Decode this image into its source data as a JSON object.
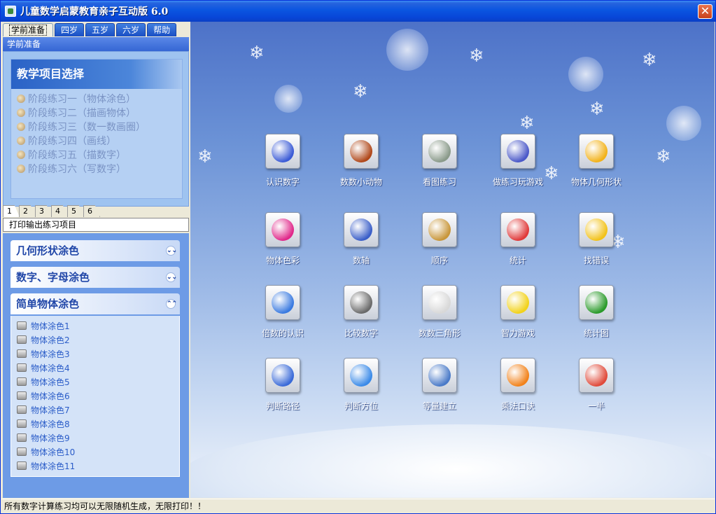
{
  "window": {
    "title": "儿童数学启蒙教育亲子互动版 6.0",
    "close_label": "✕"
  },
  "top_tabs": [
    "学前准备",
    "四岁",
    "五岁",
    "六岁",
    "帮助"
  ],
  "panel_header": "学前准备",
  "project_select": {
    "title": "教学项目选择",
    "items": [
      "阶段练习一（物体涂色）",
      "阶段练习二（描画物体）",
      "阶段练习三（数一数画圈）",
      "阶段练习四（画线）",
      "阶段练习五（描数字）",
      "阶段练习六（写数字）"
    ]
  },
  "page_tabs": [
    "1",
    "2",
    "3",
    "4",
    "5",
    "6"
  ],
  "print_section": "打印输出练习项目",
  "groups": [
    {
      "title": "几何形状涂色",
      "chevron": "⌄⌄"
    },
    {
      "title": "数字、字母涂色",
      "chevron": "⌄⌄"
    },
    {
      "title": "简单物体涂色",
      "chevron": "⌃⌃"
    }
  ],
  "leaves": [
    "物体涂色1",
    "物体涂色2",
    "物体涂色3",
    "物体涂色4",
    "物体涂色5",
    "物体涂色6",
    "物体涂色7",
    "物体涂色8",
    "物体涂色9",
    "物体涂色10",
    "物体涂色11"
  ],
  "icons": [
    {
      "label": "认识数字",
      "icon": "record-disc-icon",
      "color": "#3b5bd6"
    },
    {
      "label": "数数小动物",
      "icon": "animal-icon",
      "color": "#b0481a"
    },
    {
      "label": "看图练习",
      "icon": "calculator-icon",
      "color": "#8a9a8a"
    },
    {
      "label": "做练习玩游戏",
      "icon": "gameboy-icon",
      "color": "#4a58c8"
    },
    {
      "label": "物体几何形状",
      "icon": "star-icon",
      "color": "#f2b21a"
    },
    {
      "label": "物体色彩",
      "icon": "color-balls-icon",
      "color": "#e0288a"
    },
    {
      "label": "数轴",
      "icon": "blueprint-icon",
      "color": "#3a5ec8"
    },
    {
      "label": "顺序",
      "icon": "box-icon",
      "color": "#c8963a"
    },
    {
      "label": "统计",
      "icon": "red-button-icon",
      "color": "#e03a3a"
    },
    {
      "label": "找错误",
      "icon": "star-card-icon",
      "color": "#f2c21a"
    },
    {
      "label": "倍数的认识",
      "icon": "drive-icon",
      "color": "#3a7ae0"
    },
    {
      "label": "比较数字",
      "icon": "tools-icon",
      "color": "#6a6a6a"
    },
    {
      "label": "数数三角形",
      "icon": "mouse-icon",
      "color": "#d8d8d8"
    },
    {
      "label": "智力游戏",
      "icon": "car-icon",
      "color": "#f2d21a"
    },
    {
      "label": "统计图",
      "icon": "green-k-icon",
      "color": "#2a9a2a"
    },
    {
      "label": "判断路径",
      "icon": "spiral-icon",
      "color": "#3a6ad8"
    },
    {
      "label": "判断方位",
      "icon": "globe-icon",
      "color": "#3a8ae8"
    },
    {
      "label": "等量建立",
      "icon": "goggles-icon",
      "color": "#4a7ac8"
    },
    {
      "label": "乘法口诀",
      "icon": "nineteen-icon",
      "color": "#f2821a"
    },
    {
      "label": "一半",
      "icon": "pinwheel-icon",
      "color": "#e04a3a"
    }
  ],
  "status_text": "所有数字计算练习均可以无限随机生成，无限打印！！"
}
